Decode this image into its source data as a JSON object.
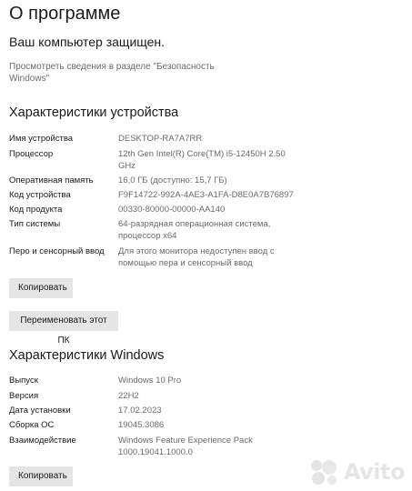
{
  "page": {
    "title": "О программе",
    "security_status": "Ваш компьютер защищен.",
    "security_link": "Просмотреть сведения в разделе \"Безопасность Windows\""
  },
  "device_specs": {
    "title": "Характеристики устройства",
    "rows": [
      {
        "label": "Имя устройства",
        "value": "DESKTOP-RA7A7RR"
      },
      {
        "label": "Процессор",
        "value": "12th Gen Intel(R) Core(TM) i5-12450H   2.50 GHz"
      },
      {
        "label": "Оперативная память",
        "value": "16,0 ГБ (доступно: 15,7 ГБ)"
      },
      {
        "label": "Код устройства",
        "value": "F9F14722-992A-4AE3-A1FA-D8E0A7B76897"
      },
      {
        "label": "Код продукта",
        "value": "00330-80000-00000-AA140"
      },
      {
        "label": "Тип системы",
        "value": "64-разрядная операционная система, процессор x64"
      },
      {
        "label": "Перо и сенсорный ввод",
        "value": "Для этого монитора недоступен ввод с помощью пера и сенсорный ввод"
      }
    ],
    "copy_button": "Копировать",
    "rename_button": "Переименовать этот ПК"
  },
  "windows_specs": {
    "title": "Характеристики Windows",
    "rows": [
      {
        "label": "Выпуск",
        "value": "Windows 10 Pro"
      },
      {
        "label": "Версия",
        "value": "22H2"
      },
      {
        "label": "Дата установки",
        "value": "17.02.2023"
      },
      {
        "label": "Сборка ОС",
        "value": "19045.3086"
      },
      {
        "label": "Взаимодействие",
        "value": "Windows Feature Experience Pack 1000.19041.1000.0"
      }
    ],
    "copy_button": "Копировать"
  },
  "watermark": {
    "text": "Avito"
  }
}
